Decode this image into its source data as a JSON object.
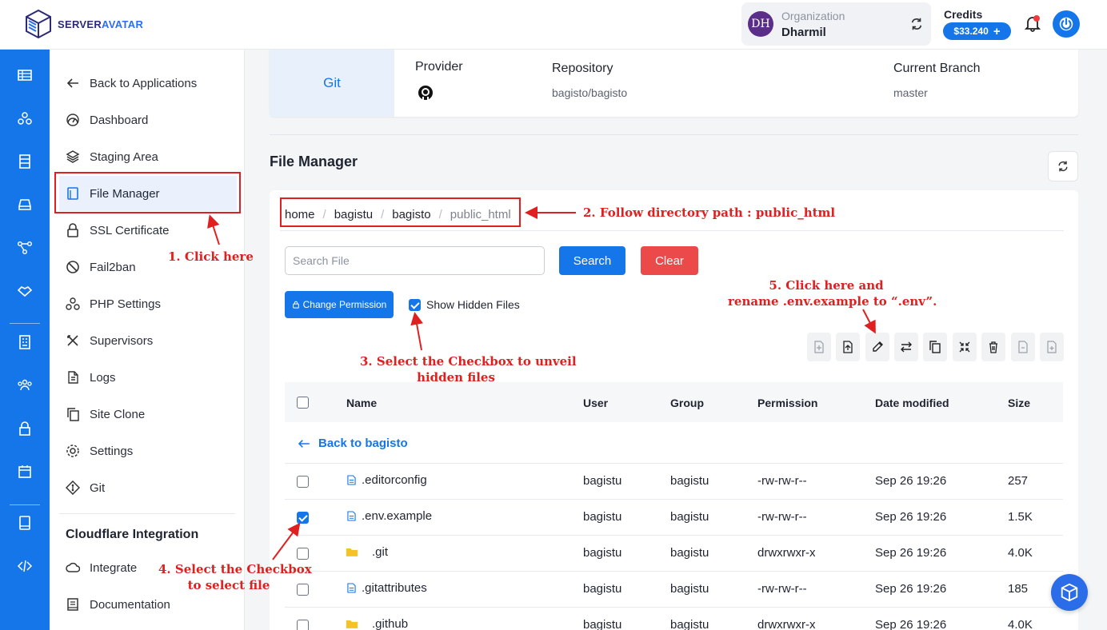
{
  "brand": {
    "part1": "SERVER",
    "part2": "AVATAR"
  },
  "org": {
    "initials": "DH",
    "label": "Organization",
    "name": "Dharmil"
  },
  "credits": {
    "label": "Credits",
    "amount": "$33.240"
  },
  "rail_icons": [
    "apps-icon",
    "network-icon",
    "servers-icon",
    "storage-icon",
    "git-flow-icon",
    "handshake-icon",
    "building-icon",
    "team-icon",
    "lock-icon",
    "calendar-icon",
    "book-icon",
    "code-icon"
  ],
  "sidebar": {
    "items": [
      {
        "label": "Back to Applications",
        "icon": "arrow-left-icon"
      },
      {
        "label": "Dashboard",
        "icon": "gauge-icon"
      },
      {
        "label": "Staging Area",
        "icon": "layers-icon"
      },
      {
        "label": "File Manager",
        "icon": "file-icon"
      },
      {
        "label": "SSL Certificate",
        "icon": "lock-icon"
      },
      {
        "label": "Fail2ban",
        "icon": "ban-icon"
      },
      {
        "label": "PHP Settings",
        "icon": "php-settings-icon"
      },
      {
        "label": "Supervisors",
        "icon": "tools-icon"
      },
      {
        "label": "Logs",
        "icon": "log-icon"
      },
      {
        "label": "Site Clone",
        "icon": "clone-icon"
      },
      {
        "label": "Settings",
        "icon": "gear-icon"
      },
      {
        "label": "Git",
        "icon": "git-icon"
      }
    ],
    "section_title": "Cloudflare Integration",
    "cf_items": [
      {
        "label": "Integrate",
        "icon": "cloud-icon"
      },
      {
        "label": "Documentation",
        "icon": "doc-icon"
      }
    ]
  },
  "git": {
    "tab": "Git",
    "provider_label": "Provider",
    "repo_label": "Repository",
    "repo": "bagisto/bagisto",
    "branch_label": "Current Branch",
    "branch": "master"
  },
  "file_manager": {
    "title": "File Manager",
    "breadcrumb": [
      "home",
      "bagistu",
      "bagisto",
      "public_html"
    ],
    "search_placeholder": "Search File",
    "search_button": "Search",
    "clear_button": "Clear",
    "change_permission": "Change Permission",
    "show_hidden_label": "Show Hidden Files",
    "show_hidden_checked": true,
    "toolbar": [
      "new-file-icon",
      "upload-icon",
      "edit-icon",
      "move-icon",
      "copy-icon",
      "compress-icon",
      "delete-icon",
      "extract-icon",
      "new-folder-icon"
    ],
    "columns": [
      "Name",
      "User",
      "Group",
      "Permission",
      "Date modified",
      "Size"
    ],
    "back_link": "Back to bagisto",
    "rows": [
      {
        "name": ".editorconfig",
        "type": "file",
        "user": "bagistu",
        "group": "bagistu",
        "perm": "-rw-rw-r--",
        "date": "Sep 26 19:26",
        "size": "257",
        "checked": false
      },
      {
        "name": ".env.example",
        "type": "file",
        "user": "bagistu",
        "group": "bagistu",
        "perm": "-rw-rw-r--",
        "date": "Sep 26 19:26",
        "size": "1.5K",
        "checked": true
      },
      {
        "name": ".git",
        "type": "folder",
        "user": "bagistu",
        "group": "bagistu",
        "perm": "drwxrwxr-x",
        "date": "Sep 26 19:26",
        "size": "4.0K",
        "checked": false
      },
      {
        "name": ".gitattributes",
        "type": "file",
        "user": "bagistu",
        "group": "bagistu",
        "perm": "-rw-rw-r--",
        "date": "Sep 26 19:26",
        "size": "185",
        "checked": false
      },
      {
        "name": ".github",
        "type": "folder",
        "user": "bagistu",
        "group": "bagistu",
        "perm": "drwxrwxr-x",
        "date": "Sep 26 19:26",
        "size": "4.0K",
        "checked": false
      }
    ]
  },
  "annotations": {
    "a1": "1. Click here",
    "a2": "2. Follow directory path :  public_html",
    "a3_line1": "3. Select the Checkbox to unveil",
    "a3_line2": "hidden files",
    "a4_line1": "4. Select the Checkbox",
    "a4_line2": "to select file",
    "a5_line1": "5. Click here and",
    "a5_line2": "rename .env.example to “.env”.",
    "color": "#e02020"
  },
  "colors": {
    "primary": "#1576ea",
    "danger": "#ec4a4a",
    "folder": "#f6c227"
  }
}
